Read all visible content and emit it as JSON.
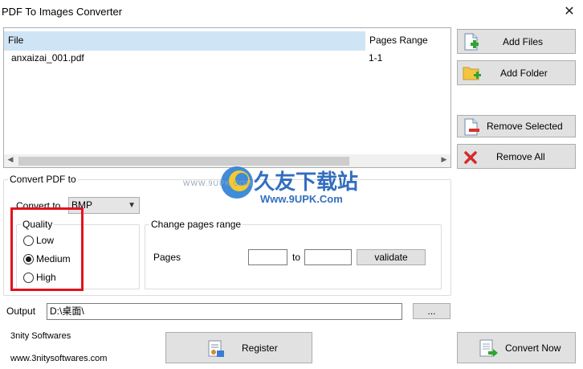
{
  "window": {
    "title": "PDF To Images Converter",
    "close_glyph": "✕"
  },
  "file_list": {
    "columns": [
      "File",
      "Pages Range"
    ],
    "rows": [
      {
        "file": "anxaizai_001.pdf",
        "range": "1-1"
      }
    ]
  },
  "side_buttons": {
    "add_files": "Add Files",
    "add_folder": "Add Folder",
    "remove_selected": "Remove Selected",
    "remove_all": "Remove All"
  },
  "convert_group": {
    "legend": "Convert PDF to",
    "convert_to_label": "Convert to",
    "format_value": "BMP",
    "quality": {
      "legend": "Quality",
      "options": [
        "Low",
        "Medium",
        "High"
      ],
      "selected": "Medium"
    }
  },
  "pages_group": {
    "legend": "Change pages range",
    "pages_label": "Pages",
    "from_value": "",
    "to_label": "to",
    "to_value": "",
    "validate": "validate"
  },
  "output": {
    "label": "Output",
    "value": "D:\\桌面\\",
    "browse": "..."
  },
  "footer": {
    "company": "3nity Softwares",
    "website": "www.3nitysoftwares.com",
    "register": "Register",
    "convert_now": "Convert Now"
  },
  "watermark": {
    "brand": "久友下载站",
    "url_large": "Www.9UPK.Com",
    "url_small": "WWW.9UPK.COM"
  },
  "colors": {
    "highlight_box": "#e0141e",
    "header_selected": "#cfe5f5",
    "button_face": "#e1e1e1"
  }
}
